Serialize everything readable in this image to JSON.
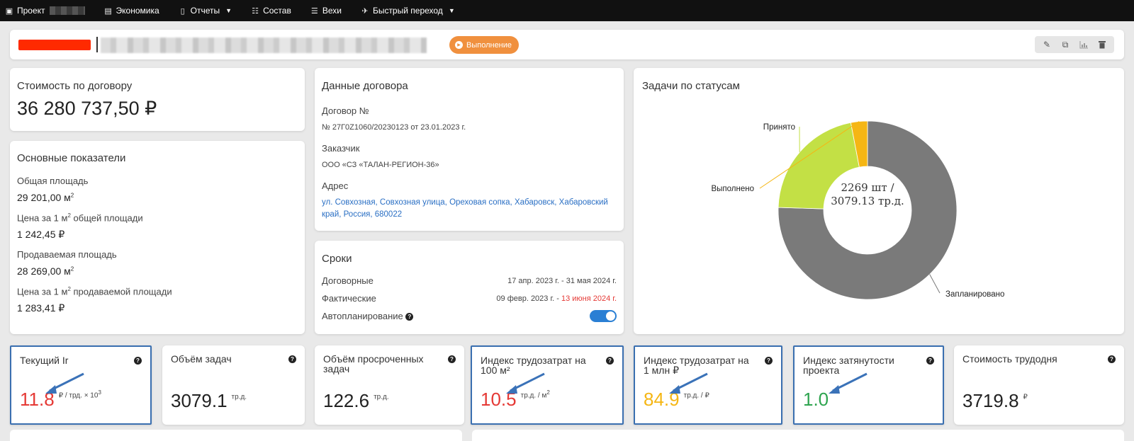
{
  "nav": {
    "project": "Проект",
    "economy": "Экономика",
    "reports": "Отчеты",
    "composition": "Состав",
    "milestones": "Вехи",
    "quick_jump": "Быстрый переход"
  },
  "titlebar": {
    "status": "Выполнение"
  },
  "contract_cost": {
    "title": "Стоимость по договору",
    "value": "36 280 737,50 ₽"
  },
  "main_indicators": {
    "title": "Основные показатели",
    "total_area_label": "Общая площадь",
    "total_area_value": "29 201,00 м",
    "price_total_label_a": "Цена за 1 м",
    "price_total_label_b": " общей площади",
    "price_total_value": "1 242,45 ₽",
    "sale_area_label": "Продаваемая площадь",
    "sale_area_value": "28 269,00 м",
    "price_sale_label_a": "Цена за 1 м",
    "price_sale_label_b": " продаваемой площади",
    "price_sale_value": "1 283,41 ₽",
    "sup": "2"
  },
  "contract_data": {
    "title": "Данные договора",
    "number_label": "Договор №",
    "number_value": "№ 27Г0Z1060/20230123 от 23.01.2023 г.",
    "customer_label": "Заказчик",
    "customer_value": "ООО «СЗ «ТАЛАН-РЕГИОН-36»",
    "address_label": "Адрес",
    "address_value": "ул. Совхозная, Совхозная улица, Ореховая сопка, Хабаровск, Хабаровский край, Россия, 680022"
  },
  "terms": {
    "title": "Сроки",
    "contract_label": "Договорные",
    "contract_value": "17 апр. 2023 г. - 31 мая 2024 г.",
    "actual_label": "Фактические",
    "actual_start": "09 февр. 2023 г. - ",
    "actual_end": "13 июня 2024 г.",
    "auto_label": "Автопланирование",
    "auto_enabled": true
  },
  "tasks_chart": {
    "title": "Задачи по статусам",
    "center_line1": "2269 шт /",
    "center_line2": "3079.13 тр.д."
  },
  "chart_data": {
    "type": "pie",
    "title": "Задачи по статусам",
    "categories": [
      "Запланировано",
      "Принято",
      "Выполнено"
    ],
    "values": [
      75.5,
      21.5,
      3.0
    ],
    "colors": [
      "#7a7a7a",
      "#c3e045",
      "#f5b614"
    ],
    "donut": true,
    "center_label": "2269 шт / 3079.13 тр.д."
  },
  "kpis": [
    {
      "title": "Текущий Ir",
      "value": "11.8",
      "unit": "₽ / трд. × 10",
      "unit_sup": "3",
      "color": "#e53935",
      "highlighted": true,
      "arrow": true
    },
    {
      "title": "Объём задач",
      "value": "3079.1",
      "unit": "тр.д.",
      "unit_sup": "",
      "color": "#222222",
      "highlighted": false,
      "arrow": false
    },
    {
      "title": "Объём просроченных задач",
      "value": "122.6",
      "unit": "тр.д.",
      "unit_sup": "",
      "color": "#222222",
      "highlighted": false,
      "arrow": false
    },
    {
      "title": "Индекс трудозатрат на 100 м²",
      "value": "10.5",
      "unit": "тр.д. / м",
      "unit_sup": "2",
      "color": "#e53935",
      "highlighted": true,
      "arrow": true
    },
    {
      "title": "Индекс трудозатрат на 1 млн ₽",
      "value": "84.9",
      "unit": "тр.д. / ₽",
      "unit_sup": "",
      "color": "#f5b614",
      "highlighted": true,
      "arrow": true
    },
    {
      "title": "Индекс затянутости проекта",
      "value": "1.0",
      "unit": "",
      "unit_sup": "",
      "color": "#2ea44f",
      "highlighted": true,
      "arrow": true
    },
    {
      "title": "Стоимость трудодня",
      "value": "3719.8",
      "unit": "₽",
      "unit_sup": "",
      "color": "#222222",
      "highlighted": false,
      "arrow": false
    }
  ]
}
